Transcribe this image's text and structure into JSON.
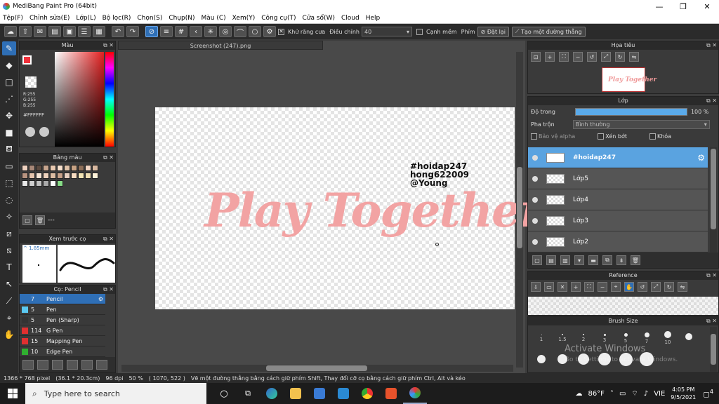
{
  "window": {
    "title": "MediBang Paint Pro (64bit)",
    "controls": [
      "—",
      "❐",
      "✕"
    ]
  },
  "menu": [
    "Tệp(F)",
    "Chỉnh sửa(E)",
    "Lớp(L)",
    "Bộ lọc(R)",
    "Chọn(S)",
    "Chụp(N)",
    "Màu (C)",
    "Xem(Y)",
    "Công cụ(T)",
    "Cửa sổ(W)",
    "Cloud",
    "Help"
  ],
  "toolbar": {
    "antialias_label": "Khử răng cưa",
    "adjust_label": "Điều chỉnh",
    "adjust_value": "40",
    "smooth_label": "Cạnh mềm",
    "key_label": "Phím",
    "reset_label": "Đặt lại",
    "line_label": "Tạo một đường thẳng"
  },
  "color_panel": {
    "title": "Màu",
    "r": "R:255",
    "g": "G:255",
    "b": "B:255",
    "hex": "#FFFFFF",
    "main_color": "#f1323c"
  },
  "palette_panel": {
    "title": "Bảng màu",
    "swatches": [
      "#f0d2c0",
      "#a88878",
      "#5b4a40",
      "#c7a58e",
      "#e9c9b0",
      "#f7e0cc",
      "#e0c2a8",
      "#c8a384",
      "#8c6e58",
      "#f2d6c4",
      "#d8b8a0",
      "#b89480",
      "#e4c4ac",
      "#f6e4d4",
      "#eed2bc",
      "#dcbca2",
      "#c6a088",
      "#e8d0c0",
      "#f7dcc0",
      "#f3e4b4",
      "#eedcb0",
      "#fff2d8",
      "#e8e8e8",
      "#d0d0d0",
      "#c2c2c2",
      "#aaaaaa",
      "#ffffff",
      "#88dd88"
    ],
    "footer_text": "---"
  },
  "preview_panel": {
    "title": "Xem trước cọ",
    "size": "1.85mm"
  },
  "brush_panel": {
    "title": "Cọ: Pencil",
    "brushes": [
      {
        "num": "7",
        "name": "Pencil",
        "color": "#2f6fb6",
        "selected": true
      },
      {
        "num": "5",
        "name": "Pen",
        "color": "#5ac8f0"
      },
      {
        "num": "5",
        "name": "Pen (Sharp)",
        "color": "#333333"
      },
      {
        "num": "114",
        "name": "G Pen",
        "color": "#e03030"
      },
      {
        "num": "15",
        "name": "Mapping Pen",
        "color": "#e03030"
      },
      {
        "num": "10",
        "name": "Edge Pen",
        "color": "#30b030"
      }
    ]
  },
  "canvas": {
    "tab": "Screenshot (247).png",
    "tag_line1": "#hoidap247",
    "tag_line2": "hong622009",
    "tag_line3": "@Young",
    "main_text": "Play Together"
  },
  "navigator": {
    "title": "Họa tiêu",
    "thumb_text": "Play Together"
  },
  "layers": {
    "title": "Lớp",
    "opacity_label": "Độ trong",
    "opacity_value": "100 %",
    "opacity_percent": 100,
    "blend_label": "Pha trộn",
    "blend_value": "Bình thường",
    "protect_alpha": "Bảo vệ alpha",
    "clipping": "Xén bớt",
    "lock": "Khóa",
    "rows": [
      {
        "name": "#hoidap247",
        "selected": true
      },
      {
        "name": "Lớp5"
      },
      {
        "name": "Lớp4"
      },
      {
        "name": "Lớp3"
      },
      {
        "name": "Lớp2"
      }
    ]
  },
  "reference": {
    "title": "Reference"
  },
  "brush_size": {
    "title": "Brush Size",
    "sizes": [
      "1",
      "1.5",
      "2",
      "3",
      "5",
      "7",
      "10"
    ],
    "watermark_line1": "Activate Windows",
    "watermark_line2": "Go to Settings to activate Windows."
  },
  "status": {
    "size": "1366 * 768 pixel",
    "dims": "(36.1 * 20.3cm)",
    "dpi": "96 dpi",
    "zoom": "50 %",
    "coords": "( 1070, 522 )",
    "hint": "Vẽ một đường thẳng bằng cách giữ phím Shift, Thay đổi cỡ cọ bằng cách giữ phím Ctrl, Alt và kéo"
  },
  "taskbar": {
    "search_placeholder": "Type here to search",
    "temp": "86°F",
    "lang": "VIE",
    "time": "4:05 PM",
    "date": "9/5/2021",
    "notif": "4"
  }
}
